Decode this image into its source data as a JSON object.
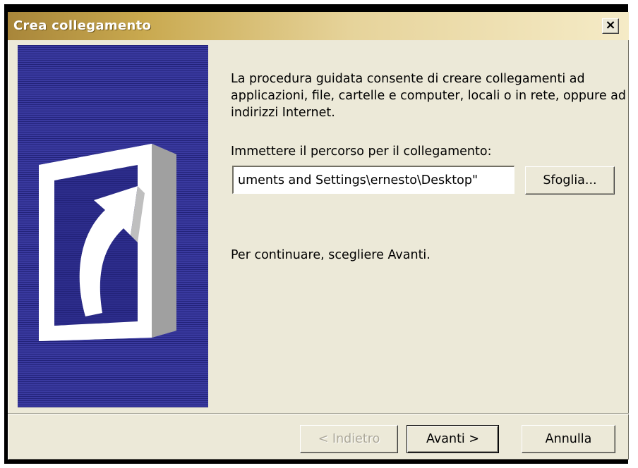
{
  "window": {
    "title": "Crea collegamento",
    "close_label": "×"
  },
  "content": {
    "intro": "La procedura guidata consente di creare collegamenti ad applicazioni, file, cartelle e computer, locali o in rete, oppure ad indirizzi Internet.",
    "path_label": "Immettere il percorso per il collegamento:",
    "path_value": "uments and Settings\\ernesto\\Desktop\"",
    "browse_label": "Sfoglia...",
    "continue_text": "Per continuare, scegliere Avanti."
  },
  "footer": {
    "back_label": "< Indietro",
    "next_label": "Avanti >",
    "cancel_label": "Annulla"
  },
  "icons": {
    "side_art": "shortcut-arrow-icon",
    "close": "close-icon"
  },
  "colors": {
    "panel_blue": "#2d2d8c",
    "dialog_bg": "#ece9d8",
    "title_gold": "#c9a94f"
  }
}
